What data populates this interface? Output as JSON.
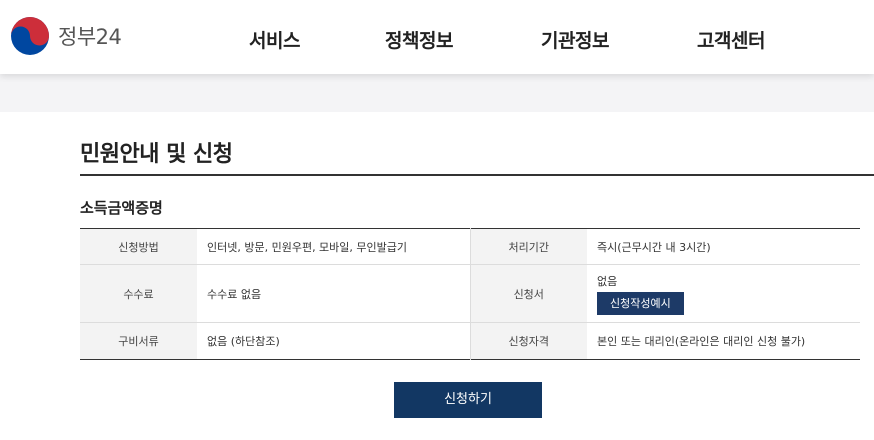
{
  "header": {
    "logo_text": "정부24",
    "nav": [
      "서비스",
      "정책정보",
      "기관정보",
      "고객센터"
    ]
  },
  "page": {
    "title": "민원안내 및 신청",
    "service_name": "소득금액증명"
  },
  "info": {
    "method_label": "신청방법",
    "method_value": "인터넷, 방문, 민원우편, 모바일, 무인발급기",
    "period_label": "처리기간",
    "period_value": "즉시(근무시간 내 3시간)",
    "fee_label": "수수료",
    "fee_value": "수수료 없음",
    "form_label": "신청서",
    "form_value": "없음",
    "form_button": "신청작성예시",
    "docs_label": "구비서류",
    "docs_value": "없음 (하단참조)",
    "eligibility_label": "신청자격",
    "eligibility_value": "본인 또는 대리인(온라인은 대리인 신청 불가)"
  },
  "apply_button": "신청하기",
  "colors": {
    "primary": "#123763",
    "button_dark": "#1d3a67",
    "logo_red": "#cd2e3a",
    "logo_blue": "#0047a0"
  }
}
